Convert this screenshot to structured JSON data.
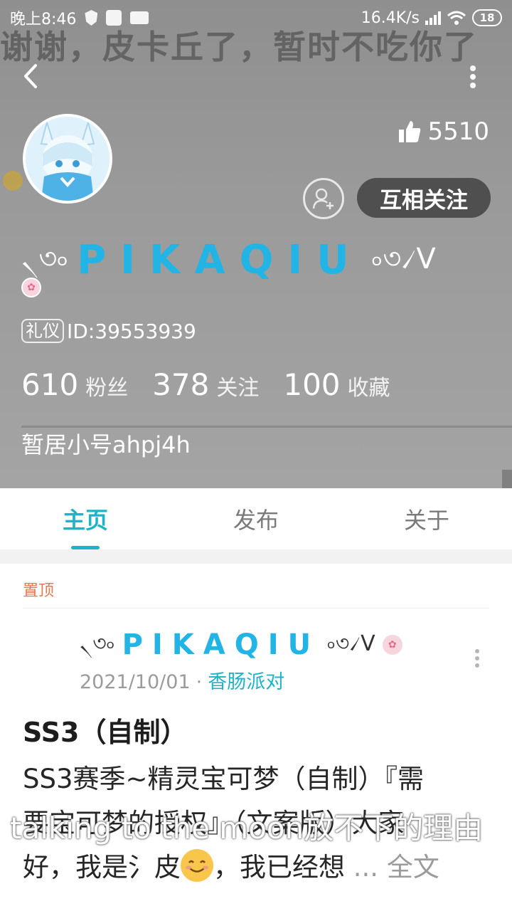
{
  "status_bar": {
    "time": "晚上8:46",
    "network_speed": "16.4K/s",
    "battery": "18"
  },
  "header": {
    "background_text": "谢谢，皮卡丘了，暂时不吃你了",
    "likes": "5510",
    "mutual_follow_label": "互相关注",
    "nickname_left_deco": "৲৩৹",
    "nickname": "PIKAQIU",
    "nickname_right_deco": "৹৩৴V",
    "id_tag": "礼仪",
    "id_text": "ID:39553939",
    "stats": [
      {
        "num": "610",
        "label": "粉丝"
      },
      {
        "num": "378",
        "label": "关注"
      },
      {
        "num": "100",
        "label": "收藏"
      }
    ],
    "bio": "暂居小号ahpj4h"
  },
  "tabs": [
    {
      "label": "主页",
      "active": true
    },
    {
      "label": "发布",
      "active": false
    },
    {
      "label": "关于",
      "active": false
    }
  ],
  "post": {
    "pinned_label": "置顶",
    "author_left_deco": "৲৩৹",
    "author_name": "PIKAQIU",
    "author_right_deco": "৹৩৴V",
    "date": "2021/10/01",
    "meta_separator": "·",
    "topic": "香肠派对",
    "title": "SS3（自制）",
    "body_line1": "SS3赛季~精灵宝可梦（自制）『需",
    "body_line2": "要宝可梦的授权』（文案版）大家",
    "body_line3a": "好，我是氵皮",
    "body_line3b": "，我已经想",
    "ellipsis": "...",
    "fulltext_label": "全文"
  },
  "subtitle_overlay": "talking to the moon放不下的理由",
  "colors": {
    "accent": "#1fb3c8",
    "nickname": "#23b4e6",
    "pinned": "#e8764f",
    "header_bg": "#9a9a9a"
  }
}
